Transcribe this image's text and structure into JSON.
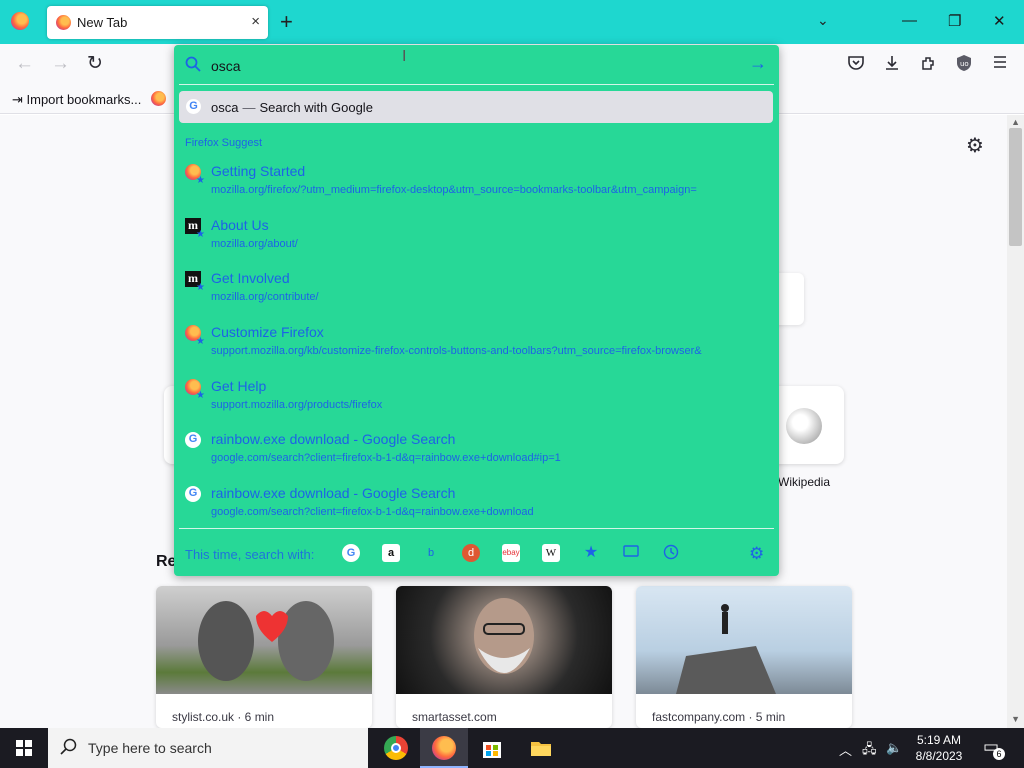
{
  "browser": {
    "tab": {
      "title": "New Tab",
      "close": "×"
    },
    "new_tab": "+",
    "tabs_list": "⌄",
    "window": {
      "minimize": "—",
      "maximize": "❐",
      "close": "✕"
    }
  },
  "nav": {
    "back": "←",
    "forward": "→",
    "reload": "↻"
  },
  "toolbar": {
    "pocket_icon": "pocket-icon",
    "downloads_icon": "download-icon",
    "extensions_icon": "extensions-icon",
    "ublock_icon": "ublock-icon",
    "menu_icon": "hamburger-menu-icon"
  },
  "bookmarks": {
    "import_label": "Import bookmarks..."
  },
  "urlbar": {
    "value": "osca",
    "selected": {
      "query": "osca",
      "separator": "—",
      "action": "Search with Google"
    },
    "suggest_header": "Firefox Suggest",
    "suggestions": [
      {
        "title": "Getting Started",
        "url": "mozilla.org/firefox/?utm_medium=firefox-desktop&utm_source=bookmarks-toolbar&utm_campaign=",
        "icon": "firefox"
      },
      {
        "title": "About Us",
        "url": "mozilla.org/about/",
        "icon": "mozilla"
      },
      {
        "title": "Get Involved",
        "url": "mozilla.org/contribute/",
        "icon": "mozilla"
      },
      {
        "title": "Customize Firefox",
        "url": "support.mozilla.org/kb/customize-firefox-controls-buttons-and-toolbars?utm_source=firefox-browser&",
        "icon": "firefox"
      },
      {
        "title": "Get Help",
        "url": "support.mozilla.org/products/firefox",
        "icon": "firefox"
      },
      {
        "title": "rainbow.exe download - Google Search",
        "url": "google.com/search?client=firefox-b-1-d&q=rainbow.exe+download#ip=1",
        "icon": "google"
      },
      {
        "title": "rainbow.exe download - Google Search",
        "url": "google.com/search?client=firefox-b-1-d&q=rainbow.exe+download",
        "icon": "google"
      }
    ],
    "oneoff_label": "This time, search with:",
    "oneoff_engines": [
      "google-icon",
      "amazon-icon",
      "bing-icon",
      "duckduckgo-icon",
      "ebay-icon",
      "wikipedia-icon",
      "bookmarks-icon",
      "tabs-icon",
      "history-icon"
    ]
  },
  "page": {
    "top_site_label": "Wikipedia",
    "recent_heading": "Re",
    "cards": [
      {
        "source": "stylist.co.uk · 6 min"
      },
      {
        "source": "smartasset.com"
      },
      {
        "source": "fastcompany.com · 5 min"
      }
    ]
  },
  "taskbar": {
    "search_placeholder": "Type here to search",
    "time": "5:19 AM",
    "date": "8/8/2023",
    "notifications": "6"
  },
  "colors": {
    "tabbar": "#1ed7cf",
    "urlbar_popup": "#27d897",
    "link": "#1d63e6"
  }
}
